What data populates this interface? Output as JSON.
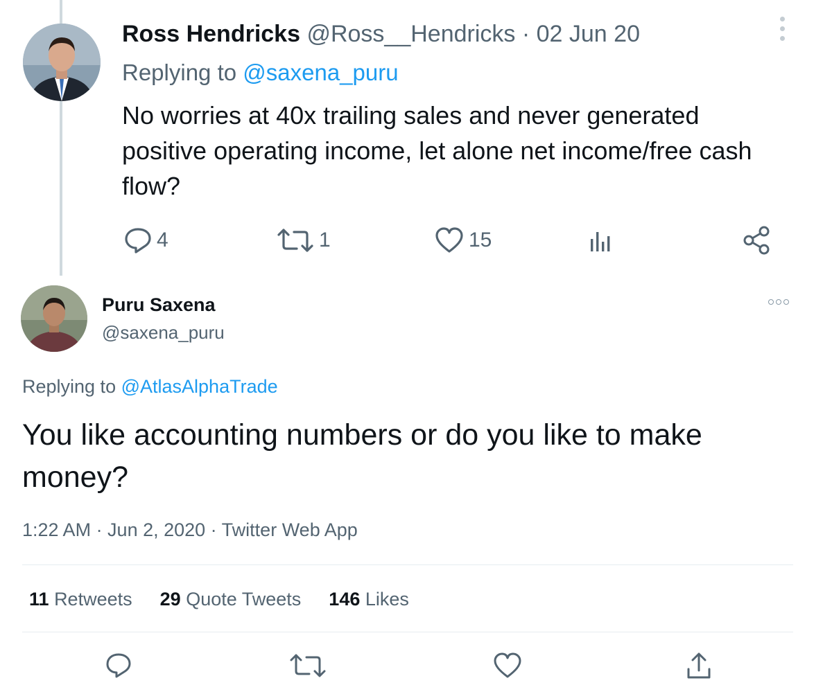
{
  "tweet1": {
    "name": "Ross Hendricks",
    "handle": "@Ross__Hendricks",
    "date": "· 02 Jun 20",
    "replying_prefix": "Replying to ",
    "replying_to": "@saxena_puru",
    "text": "No worries at 40x trailing sales and never generated positive operating income, let alone net income/free cash flow?",
    "replies": "4",
    "retweets": "1",
    "likes": "15"
  },
  "tweet2": {
    "name": "Puru Saxena",
    "handle": "@saxena_puru",
    "replying_prefix": "Replying to ",
    "replying_to": "@AtlasAlphaTrade",
    "text": "You like accounting numbers or do you like to make money?",
    "timestamp": "1:22 AM · Jun 2, 2020 · Twitter Web App",
    "stats": {
      "retweets_count": "11",
      "retweets_label": "Retweets",
      "quotes_count": "29",
      "quotes_label": "Quote Tweets",
      "likes_count": "146",
      "likes_label": "Likes"
    }
  },
  "colors": {
    "link": "#1d9bf0",
    "secondary_text": "#536471",
    "primary_text": "#0f1419",
    "thread_line": "#cfd9de"
  },
  "icons": {
    "reply": "reply-icon",
    "retweet": "retweet-icon",
    "like": "heart-icon",
    "analytics": "analytics-icon",
    "share": "share-icon",
    "more": "more-icon"
  }
}
